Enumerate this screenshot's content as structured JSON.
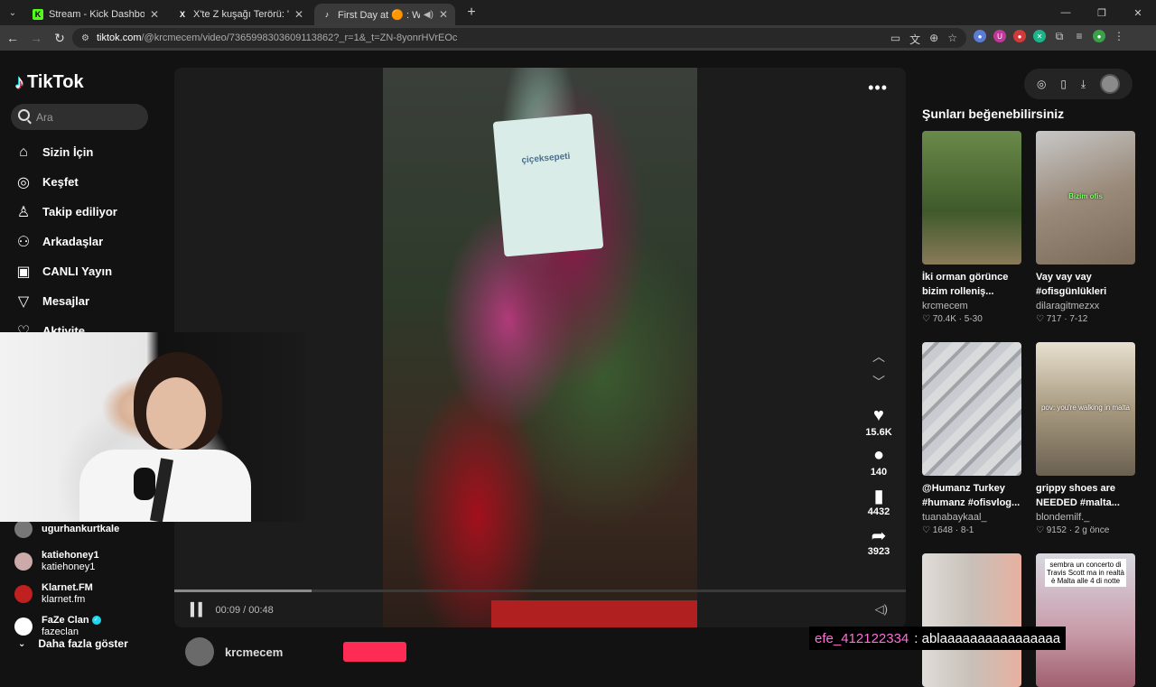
{
  "browser": {
    "tabs": [
      {
        "title": "Stream - Kick Dashboard",
        "favicon": "K",
        "fav_color": "#53fc18"
      },
      {
        "title": "X'te Z kuşağı Terörü: \"Dünyanın",
        "favicon": "X",
        "fav_color": "#000000"
      },
      {
        "title": "First Day at 🟠 : Work Vlog",
        "favicon": "♪",
        "fav_color": "#000000",
        "active": true
      }
    ],
    "url_host": "tiktok.com",
    "url_path": "/@krcmecem/video/7365998303609113862?_r=1&_t=ZN-8yonrHVrEOc"
  },
  "sidebar": {
    "logo": "TikTok",
    "search_placeholder": "Ara",
    "nav": [
      {
        "label": "Sizin İçin",
        "icon": "home-icon",
        "glyph": "⌂"
      },
      {
        "label": "Keşfet",
        "icon": "compass-icon",
        "glyph": "◎"
      },
      {
        "label": "Takip ediliyor",
        "icon": "following-icon",
        "glyph": "♙"
      },
      {
        "label": "Arkadaşlar",
        "icon": "friends-icon",
        "glyph": "⚇"
      },
      {
        "label": "CANLI Yayın",
        "icon": "live-icon",
        "glyph": "▣"
      },
      {
        "label": "Mesajlar",
        "icon": "messages-icon",
        "glyph": "▽"
      },
      {
        "label": "Aktivite",
        "icon": "activity-icon",
        "glyph": "♡"
      }
    ],
    "following": [
      {
        "name": "ugurhankurtkale",
        "handle": "",
        "color": "#777"
      },
      {
        "name": "katiehoney1",
        "handle": "katiehoney1",
        "color": "#caa"
      },
      {
        "name": "Klarnet.FM",
        "handle": "klarnet.fm",
        "color": "#c02020"
      },
      {
        "name": "FaZe Clan",
        "handle": "fazeclan",
        "color": "#fff",
        "verified": true
      }
    ],
    "more_label": "Daha fazla göster"
  },
  "video": {
    "box_text": "çiçeksepeti",
    "likes": "15.6K",
    "comments": "140",
    "saves": "4432",
    "shares": "3923",
    "time": "00:09 / 00:48",
    "progress": 0.1875,
    "author": "krcmecem"
  },
  "suggestions": {
    "title": "Şunları beğenebilirsiniz",
    "cards": [
      {
        "caption": "İki orman görünce bizim rolleniş...",
        "user": "krcmecem",
        "likes": "70.4K",
        "date": "5-30",
        "color": "#3f5a2a",
        "overlay": ""
      },
      {
        "caption": "Vay vay vay #ofisgünlükleri",
        "user": "dilaragitmezxx",
        "likes": "717",
        "date": "7-12",
        "color": "#9a8a7a",
        "overlay": "Bizim ofis"
      },
      {
        "caption": "@Humanz Turkey #humanz #ofisvlog...",
        "user": "tuanabaykaal_",
        "likes": "1648",
        "date": "8-1",
        "color": "#b0b4b8",
        "overlay": ""
      },
      {
        "caption": "grippy shoes are NEEDED #malta...",
        "user": "blondemilf._",
        "likes": "9152",
        "date": "2 g önce",
        "color": "#a89a80",
        "overlay": "pov: you're walking in malta"
      },
      {
        "caption": "",
        "user": "",
        "likes": "",
        "date": "",
        "color": "#c8c0b8",
        "overlay": ""
      },
      {
        "caption": "",
        "user": "",
        "likes": "",
        "date": "",
        "color": "#c89aa8",
        "overlay": "sembra un concerto di Travis Scott ma in realtà è Malta alle 4 di notte"
      }
    ]
  },
  "chat": {
    "user": "efe_412122334",
    "message": ": ablaaaaaaaaaaaaaaaa"
  }
}
